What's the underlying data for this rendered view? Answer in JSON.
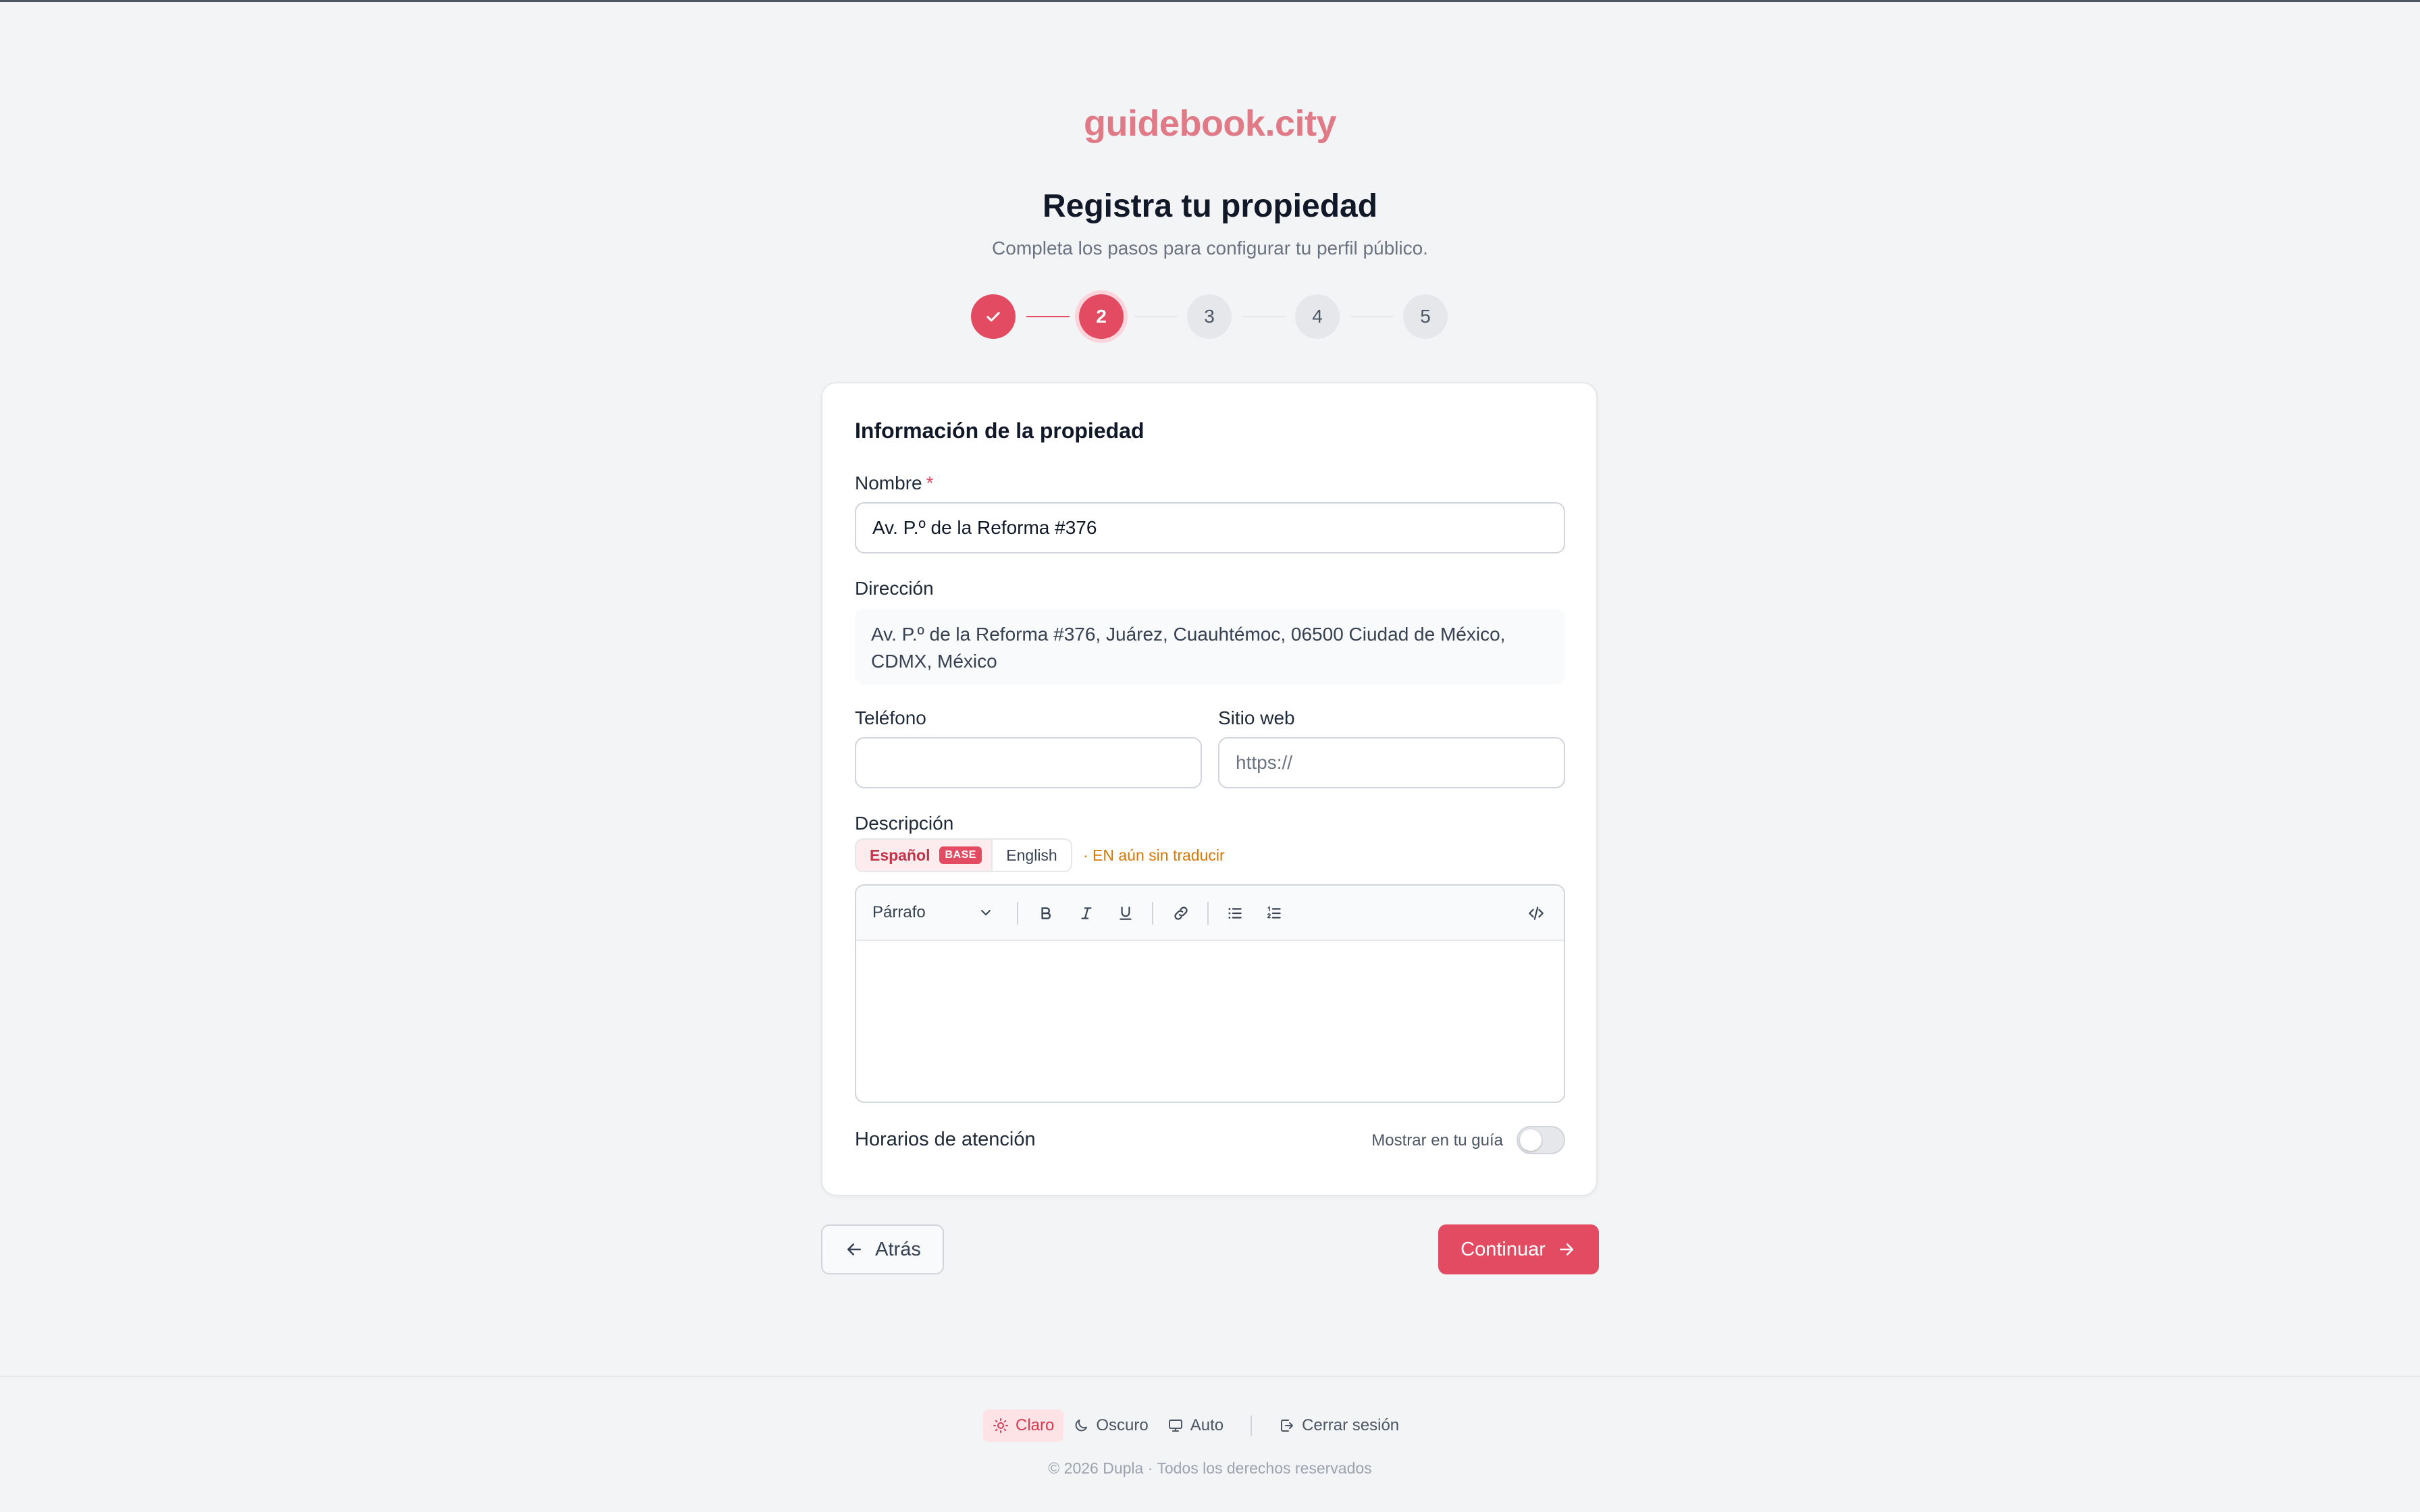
{
  "brand": "guidebook.city",
  "header": {
    "title": "Registra tu propiedad",
    "subtitle": "Completa los pasos para configurar tu perfil público."
  },
  "stepper": {
    "steps": [
      {
        "label": "✓",
        "state": "done"
      },
      {
        "label": "2",
        "state": "current"
      },
      {
        "label": "3",
        "state": "todo"
      },
      {
        "label": "4",
        "state": "todo"
      },
      {
        "label": "5",
        "state": "todo"
      }
    ]
  },
  "form": {
    "section_title": "Información de la propiedad",
    "name_label": "Nombre",
    "name_required": "*",
    "name_value": "Av. P.º de la Reforma #376",
    "address_label": "Dirección",
    "address_value": "Av. P.º de la Reforma #376, Juárez, Cuauhtémoc, 06500 Ciudad de México, CDMX, México",
    "phone_label": "Teléfono",
    "phone_value": "",
    "website_label": "Sitio web",
    "website_placeholder": "https://",
    "description_label": "Descripción",
    "lang_es": "Español",
    "lang_base_badge": "BASE",
    "lang_en": "English",
    "lang_note": "· EN aún sin traducir",
    "editor": {
      "block_type": "Párrafo",
      "tools": [
        "bold-icon",
        "italic-icon",
        "underline-icon",
        "link-icon",
        "bullet-list-icon",
        "numbered-list-icon",
        "code-icon"
      ],
      "content": ""
    },
    "hours_label": "Horarios de atención",
    "hours_toggle_label": "Mostrar en tu guía",
    "hours_toggle_on": false
  },
  "nav": {
    "back_label": "Atrás",
    "next_label": "Continuar"
  },
  "footer": {
    "theme_light": "Claro",
    "theme_dark": "Oscuro",
    "theme_auto": "Auto",
    "logout": "Cerrar sesión",
    "copyright": "© 2026 Dupla · Todos los derechos reservados"
  },
  "colors": {
    "accent": "#e24b61",
    "brand": "#e07a86",
    "warning": "#d97706"
  }
}
